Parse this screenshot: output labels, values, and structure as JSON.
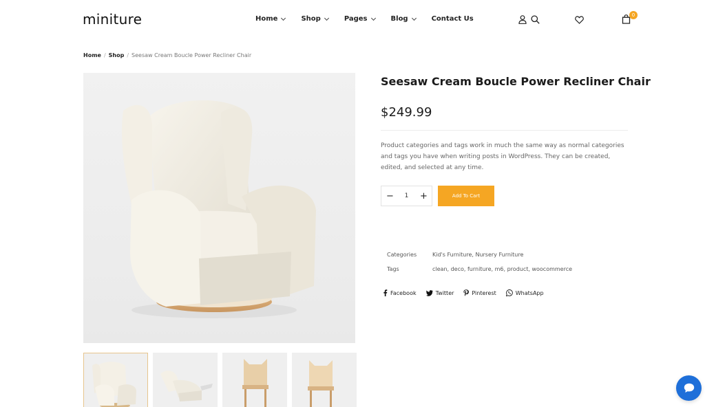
{
  "header": {
    "logo": "miniture",
    "nav": [
      {
        "label": "Home",
        "has_dropdown": true
      },
      {
        "label": "Shop",
        "has_dropdown": true
      },
      {
        "label": "Pages",
        "has_dropdown": true
      },
      {
        "label": "Blog",
        "has_dropdown": true
      },
      {
        "label": "Contact Us",
        "has_dropdown": false
      }
    ],
    "cart_count": "0",
    "icons": [
      "user-icon",
      "search-icon",
      "heart-icon",
      "bag-icon"
    ]
  },
  "breadcrumb": {
    "home": "Home",
    "shop": "Shop",
    "separator": "/",
    "current": "Seesaw Cream Boucle Power Recliner Chair"
  },
  "product": {
    "title": "Seesaw Cream Boucle Power Recliner Chair",
    "price": "$249.99",
    "description": "Product categories and tags work in much the same way as normal categories and tags you have when writing posts in WordPress. They can be created, edited, and selected at any time.",
    "quantity": "1",
    "add_to_cart_label": "Add To Cart",
    "meta": {
      "categories_label": "Categories",
      "categories_value": "Kid's Furniture, Nursery Furniture",
      "tags_label": "Tags",
      "tags_value": "clean, deco, furniture, m6, product, woocommerce"
    },
    "share": [
      {
        "label": "Facebook",
        "icon": "facebook-icon"
      },
      {
        "label": "Twitter",
        "icon": "twitter-icon"
      },
      {
        "label": "Pinterest",
        "icon": "pinterest-icon"
      },
      {
        "label": "WhatsApp",
        "icon": "whatsapp-icon"
      }
    ]
  },
  "colors": {
    "accent": "#f5a623",
    "chat_button": "#1e6fd9"
  }
}
